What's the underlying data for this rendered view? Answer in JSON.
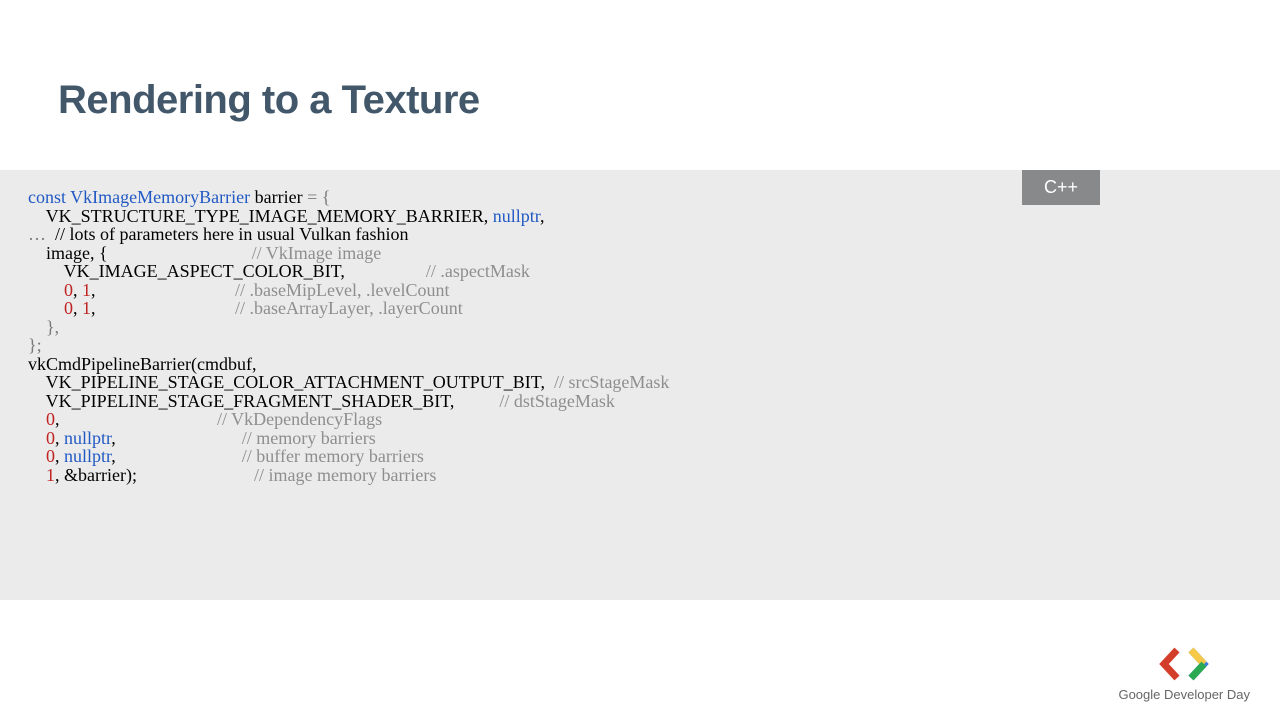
{
  "title": "Rendering to a Texture",
  "lang_badge": "C++",
  "code": {
    "l1": {
      "a": "const ",
      "b": "VkImageMemoryBarrier",
      "c": " barrier",
      "d": " = {"
    },
    "l2": {
      "a": "    VK_STRUCTURE_TYPE_IMAGE_MEMORY_BARRIER, ",
      "b": "nullptr",
      "c": ","
    },
    "l3": {
      "a": "…  ",
      "b": "// lots of parameters here in usual Vulkan fashion"
    },
    "l4": {
      "a": "    image, {                                ",
      "b": "// VkImage image"
    },
    "l5": {
      "a": "        VK_IMAGE_ASPECT_COLOR_BIT,                  ",
      "b": "// .aspectMask"
    },
    "l6": {
      "a": "        ",
      "b": "0",
      "c": ", ",
      "d": "1",
      "e": ",                               ",
      "f": "// .baseMipLevel, .levelCount"
    },
    "l7": {
      "a": "        ",
      "b": "0",
      "c": ", ",
      "d": "1",
      "e": ",                               ",
      "f": "// .baseArrayLayer, .layerCount"
    },
    "l8": {
      "a": "    },"
    },
    "l9": {
      "a": "};"
    },
    "l10": {
      "a": "vkCmdPipelineBarrier(cmdbuf,"
    },
    "l11": {
      "a": "    VK_PIPELINE_STAGE_COLOR_ATTACHMENT_OUTPUT_BIT,  ",
      "b": "// srcStageMask"
    },
    "l12": {
      "a": "    VK_PIPELINE_STAGE_FRAGMENT_SHADER_BIT,          ",
      "b": "// dstStageMask"
    },
    "l13": {
      "a": "    ",
      "b": "0",
      "c": ",                                   ",
      "d": "// VkDependencyFlags"
    },
    "l14": {
      "a": "    ",
      "b": "0",
      "c": ", ",
      "d": "nullptr",
      "e": ",                            ",
      "f": "// memory barriers"
    },
    "l15": {
      "a": "    ",
      "b": "0",
      "c": ", ",
      "d": "nullptr",
      "e": ",                            ",
      "f": "// buffer memory barriers"
    },
    "l16": {
      "a": "    ",
      "b": "1",
      "c": ", &",
      "d": "barrier",
      "e": ");                          ",
      "f": "// image memory barriers"
    }
  },
  "footer": {
    "brand1": "Google",
    "brand2": " Developer Day"
  },
  "colors": {
    "left_chev": "#d23e2a",
    "right_chev": "#3b7de0",
    "right_chev2": "#f7c948",
    "right_chev3": "#2aa952"
  }
}
